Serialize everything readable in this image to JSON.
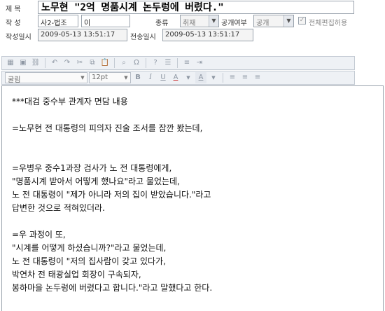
{
  "meta": {
    "title_label": "제    목",
    "title_value": "노무현 \"2억 명품시계 논두렁에 버렸다.\"",
    "author_label": "작    성",
    "author_dept": "사2-법조",
    "author_name": "이",
    "category_label": "종류",
    "category_value": "취재",
    "public_label": "공개여부",
    "public_value": "공개",
    "allow_edit_label": "전체편집허용",
    "created_label": "작성일시",
    "created_value": "2009-05-13 13:51:17",
    "sent_label": "전송일시",
    "sent_value": "2009-05-13 13:51:17"
  },
  "toolbar": {
    "font_value": "굴림",
    "size_value": "12pt",
    "bold": "B",
    "italic": "I",
    "underline": "U",
    "font_color": "A",
    "highlight": "A"
  },
  "body": {
    "lines": [
      "***대검 중수부 관계자 면담 내용",
      "",
      "=노무현 전 대통령의 피의자 진술 조서를 잠깐 봤는데,",
      "",
      "",
      "=우병우 중수1과장 검사가 노 전 대통령에게,",
      "\"명품시계 받아서 어떻게 했나요\"라고 물었는데,",
      "노 전 대통령이 \"제가 아니라 저의 집이 받았습니다.\"라고",
      "답변한 것으로 적혀있더라.",
      "",
      "=우 과정이 또,",
      "\"시계를 어떻게 하셨습니까?\"라고 물었는데,",
      "노 전 대통령이 \"저의 집사람이 갖고 있다가,",
      "박연차 전 태광실업 회장이 구속되자,",
      "봉하마을 논두렁에 버렸다고 합니다.\"라고 말했다고 한다."
    ]
  }
}
